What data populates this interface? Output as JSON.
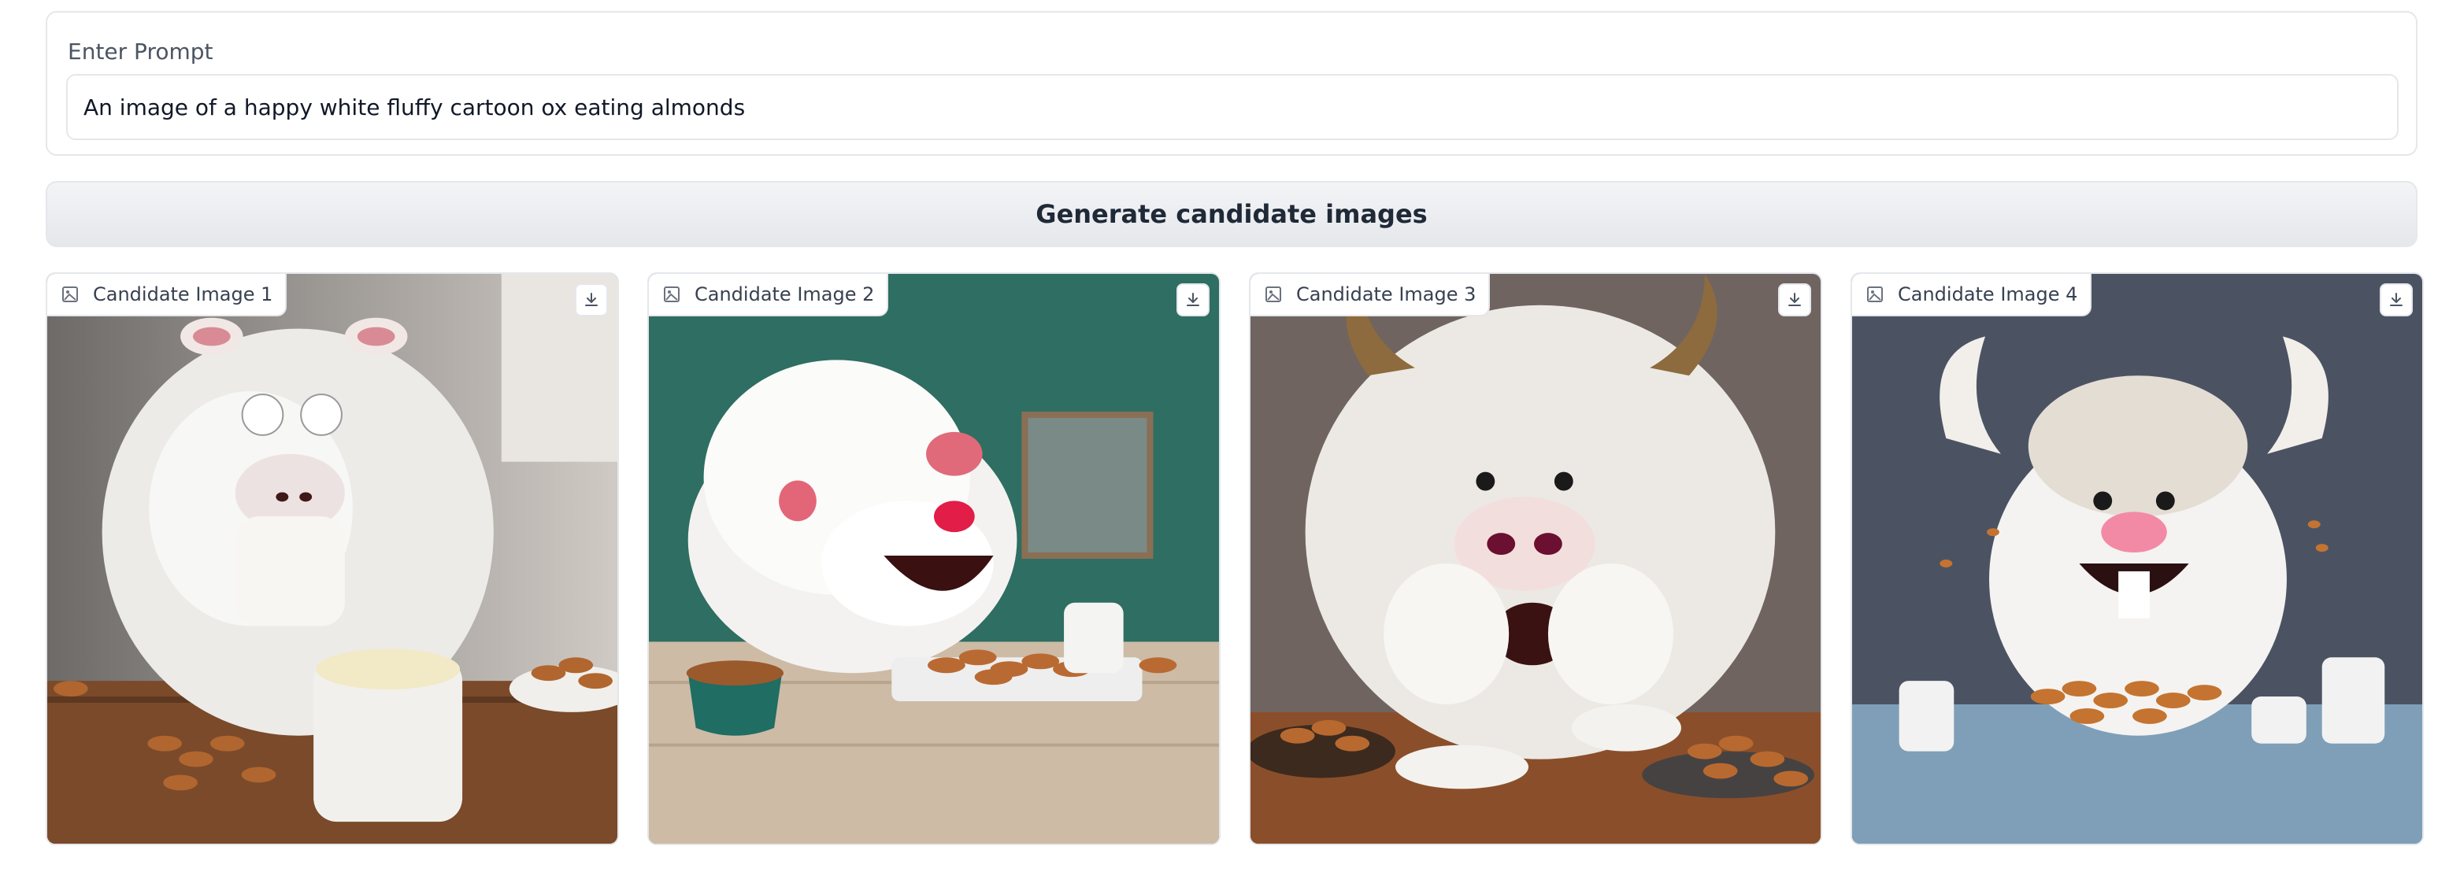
{
  "prompt": {
    "label": "Enter Prompt",
    "value": "An image of a happy white fluffy cartoon ox eating almonds"
  },
  "generate_button": {
    "label": "Generate candidate images"
  },
  "candidates": [
    {
      "label": "Candidate Image 1"
    },
    {
      "label": "Candidate Image 2"
    },
    {
      "label": "Candidate Image 3"
    },
    {
      "label": "Candidate Image 4"
    }
  ],
  "icons": {
    "label_icon": "image-icon",
    "download_icon": "download-icon"
  },
  "colors": {
    "border": "#e5e7eb",
    "button_bg": "#e5e7eb",
    "text": "#1f2937"
  }
}
